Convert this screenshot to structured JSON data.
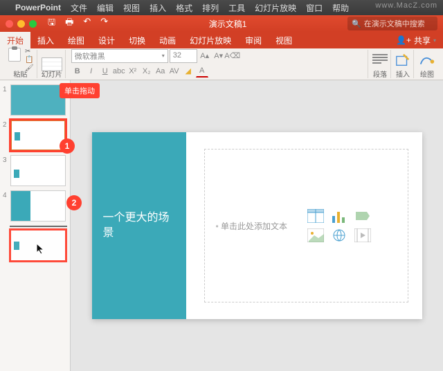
{
  "menubar": {
    "app": "PowerPoint",
    "items": [
      "文件",
      "编辑",
      "视图",
      "插入",
      "格式",
      "排列",
      "工具",
      "幻灯片放映",
      "窗口",
      "帮助"
    ]
  },
  "watermark": "www.MacZ.com",
  "titlebar": {
    "title": "演示文稿1",
    "search_placeholder": "在演示文稿中搜索"
  },
  "tabs": {
    "items": [
      "开始",
      "插入",
      "绘图",
      "设计",
      "切换",
      "动画",
      "幻灯片放映",
      "审阅",
      "视图"
    ],
    "active": 0,
    "share": "共享"
  },
  "ribbon": {
    "paste": "粘贴",
    "slides": "幻灯片",
    "font_name": "微软雅黑",
    "font_size": "32",
    "para": "段落",
    "insert": "插入",
    "draw": "绘图"
  },
  "annotations": {
    "callout": "单击拖动",
    "badge1": "1",
    "badge2": "2"
  },
  "thumbs": {
    "items": [
      "1",
      "2",
      "3",
      "4"
    ]
  },
  "slide": {
    "title": "一个更大的场景",
    "placeholder": "单击此处添加文本"
  }
}
